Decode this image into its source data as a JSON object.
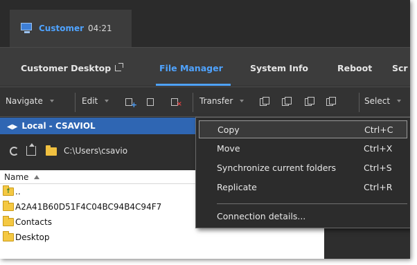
{
  "session_tab": {
    "name": "Customer",
    "time": "04:21",
    "icon": "monitor-icon"
  },
  "nav": {
    "items": [
      {
        "label": "Customer Desktop",
        "external_icon": "external-link-icon"
      },
      {
        "label": "File Manager",
        "active": true
      },
      {
        "label": "System Info"
      },
      {
        "label": "Reboot"
      },
      {
        "label": "Scr"
      }
    ],
    "accent_color": "#4fa3ff"
  },
  "toolbar": {
    "navigate_label": "Navigate",
    "edit_label": "Edit",
    "transfer_label": "Transfer",
    "select_label": "Select",
    "edit_icons": [
      "new-folder-icon",
      "rename-icon",
      "delete-icon"
    ],
    "transfer_icons": [
      "copy-icon",
      "move-icon",
      "sync-icon",
      "replicate-icon"
    ]
  },
  "local_panel": {
    "title": "Local - CSAVIOL",
    "path": "C:\\Users\\csavio",
    "header_color": "#2f66b3"
  },
  "file_list": {
    "column_name": "Name",
    "rows": [
      {
        "name": "..",
        "type": "parent"
      },
      {
        "name": "A2A41B60D51F4C04BC94B4C94F7",
        "type": "folder"
      },
      {
        "name": "Contacts",
        "type": "folder"
      },
      {
        "name": "Desktop",
        "type": "folder"
      }
    ]
  },
  "transfer_menu": {
    "items": [
      {
        "label": "Copy",
        "shortcut": "Ctrl+C",
        "highlighted": true
      },
      {
        "label": "Move",
        "shortcut": "Ctrl+X"
      },
      {
        "label": "Synchronize current folders",
        "shortcut": "Ctrl+S"
      },
      {
        "label": "Replicate",
        "shortcut": "Ctrl+R"
      },
      {
        "label": "Connection details...",
        "shortcut": ""
      }
    ]
  }
}
